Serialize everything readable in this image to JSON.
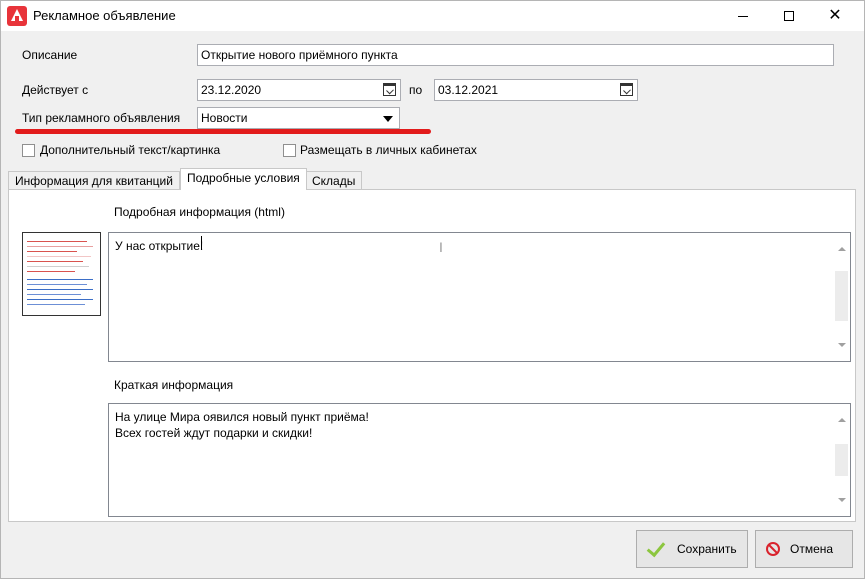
{
  "window": {
    "title": "Рекламное объявление"
  },
  "form": {
    "description_label": "Описание",
    "description_value": "Открытие нового приёмного пункта",
    "valid_from_label": "Действует с",
    "valid_from_value": "23.12.2020",
    "to_label": "по",
    "valid_to_value": "03.12.2021",
    "ad_type_label": "Тип рекламного объявления",
    "ad_type_value": "Новости",
    "extra_text_label": "Дополнительный текст/картинка",
    "extra_text_checked": false,
    "place_in_cabinets_label": "Размещать в личных кабинетах",
    "place_in_cabinets_checked": false
  },
  "tabs": [
    {
      "label": "Информация для квитанций",
      "active": false
    },
    {
      "label": "Подробные условия",
      "active": true
    },
    {
      "label": "Склады",
      "active": false
    }
  ],
  "details": {
    "detailed_label": "Подробная информация (html)",
    "detailed_text": "У нас открытие!",
    "short_label": "Краткая информация",
    "short_text_line1": "На улице Мира оявился новый пункт приёма!",
    "short_text_line2": "Всех гостей ждут подарки и скидки!"
  },
  "buttons": {
    "save_label": "Сохранить",
    "cancel_label": "Отмена"
  },
  "colors": {
    "annotation_underline": "#e21b1b",
    "save_icon": "#8cc63f",
    "cancel_icon": "#d9232d",
    "app_logo": "#e8343a"
  }
}
